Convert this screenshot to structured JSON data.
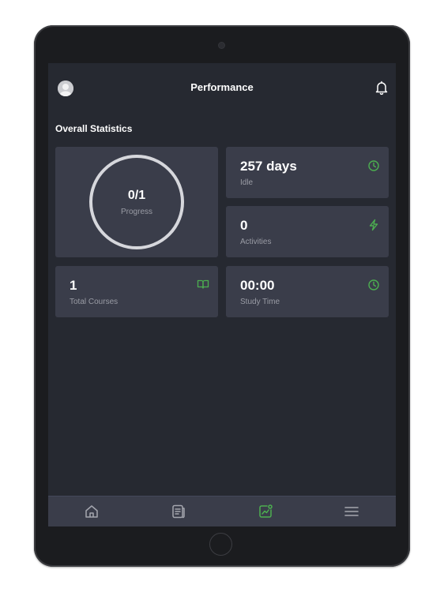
{
  "header": {
    "title": "Performance",
    "avatar_icon": "user-avatar-icon",
    "notification_icon": "bell-icon"
  },
  "section": {
    "title": "Overall Statistics"
  },
  "stats": {
    "progress": {
      "value": "0/1",
      "label": "Progress",
      "fraction": 0
    },
    "idle": {
      "value": "257 days",
      "label": "Idle",
      "icon": "clock-icon"
    },
    "activities": {
      "value": "0",
      "label": "Activities",
      "icon": "lightning-icon"
    },
    "courses": {
      "value": "1",
      "label": "Total Courses",
      "icon": "book-icon"
    },
    "study_time": {
      "value": "00:00",
      "label": "Study Time",
      "icon": "clock-icon"
    }
  },
  "nav": {
    "items": [
      {
        "name": "home",
        "icon": "home-icon",
        "active": false
      },
      {
        "name": "courses",
        "icon": "document-list-icon",
        "active": false
      },
      {
        "name": "performance",
        "icon": "chart-trend-icon",
        "active": true
      },
      {
        "name": "menu",
        "icon": "hamburger-menu-icon",
        "active": false
      }
    ]
  },
  "colors": {
    "accent": "#4caf50",
    "background": "#262931",
    "card": "#3a3d4a",
    "text_muted": "#9a9ca5"
  }
}
